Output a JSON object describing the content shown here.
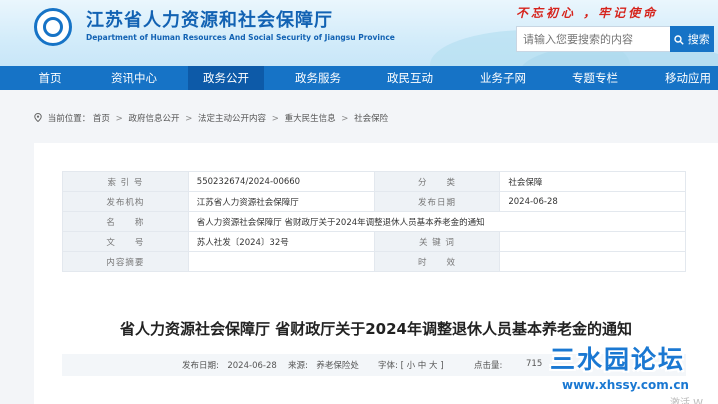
{
  "header": {
    "title": "江苏省人力资源和社会保障厅",
    "subtitle": "Department of Human Resources And Social Security of Jiangsu Province",
    "slogan": "不忘初心 ，牢记使命",
    "search_placeholder": "请输入您要搜索的内容",
    "search_button": "搜索"
  },
  "nav": {
    "items": [
      {
        "label": "首页"
      },
      {
        "label": "资讯中心"
      },
      {
        "label": "政务公开"
      },
      {
        "label": "政务服务"
      },
      {
        "label": "政民互动"
      },
      {
        "label": "业务子网"
      },
      {
        "label": "专题专栏"
      },
      {
        "label": "移动应用"
      }
    ],
    "active_index": 2
  },
  "breadcrumb": {
    "prefix": "当前位置：",
    "items": [
      "首页",
      "政府信息公开",
      "法定主动公开内容",
      "重大民生信息",
      "社会保险"
    ],
    "separator": ">"
  },
  "meta": {
    "index_label": "索 引 号",
    "index_value": "550232674/2024-00660",
    "category_label": "分　　类",
    "category_value": "社会保障",
    "org_label": "发布机构",
    "org_value": "江苏省人力资源社会保障厅",
    "date_label": "发布日期",
    "date_value": "2024-06-28",
    "name_label": "名　　称",
    "name_value": "省人力资源社会保障厅 省财政厅关于2024年调整退休人员基本养老金的通知",
    "docno_label": "文　　号",
    "docno_value": "苏人社发〔2024〕32号",
    "keyword_label": "关 键 词",
    "keyword_value": "",
    "summary_label": "内容摘要",
    "summary_value": "",
    "validity_label": "时　　效",
    "validity_value": ""
  },
  "document": {
    "title": "省人力资源社会保障厅 省财政厅关于2024年调整退休人员基本养老金的通知"
  },
  "info_bar": {
    "date": "发布日期:　2024-06-28",
    "source": "来源:　养老保险处",
    "font_size": "字体: [ 小 中 大 ]",
    "hits_label": "点击量:",
    "hits_value": "715"
  },
  "watermark": {
    "brand": "三水园论坛",
    "url": "www.xhssy.com.cn",
    "corner_text": "激活 W"
  },
  "colors": {
    "brand_blue": "#1673c6",
    "slogan_red": "#d6231c"
  }
}
